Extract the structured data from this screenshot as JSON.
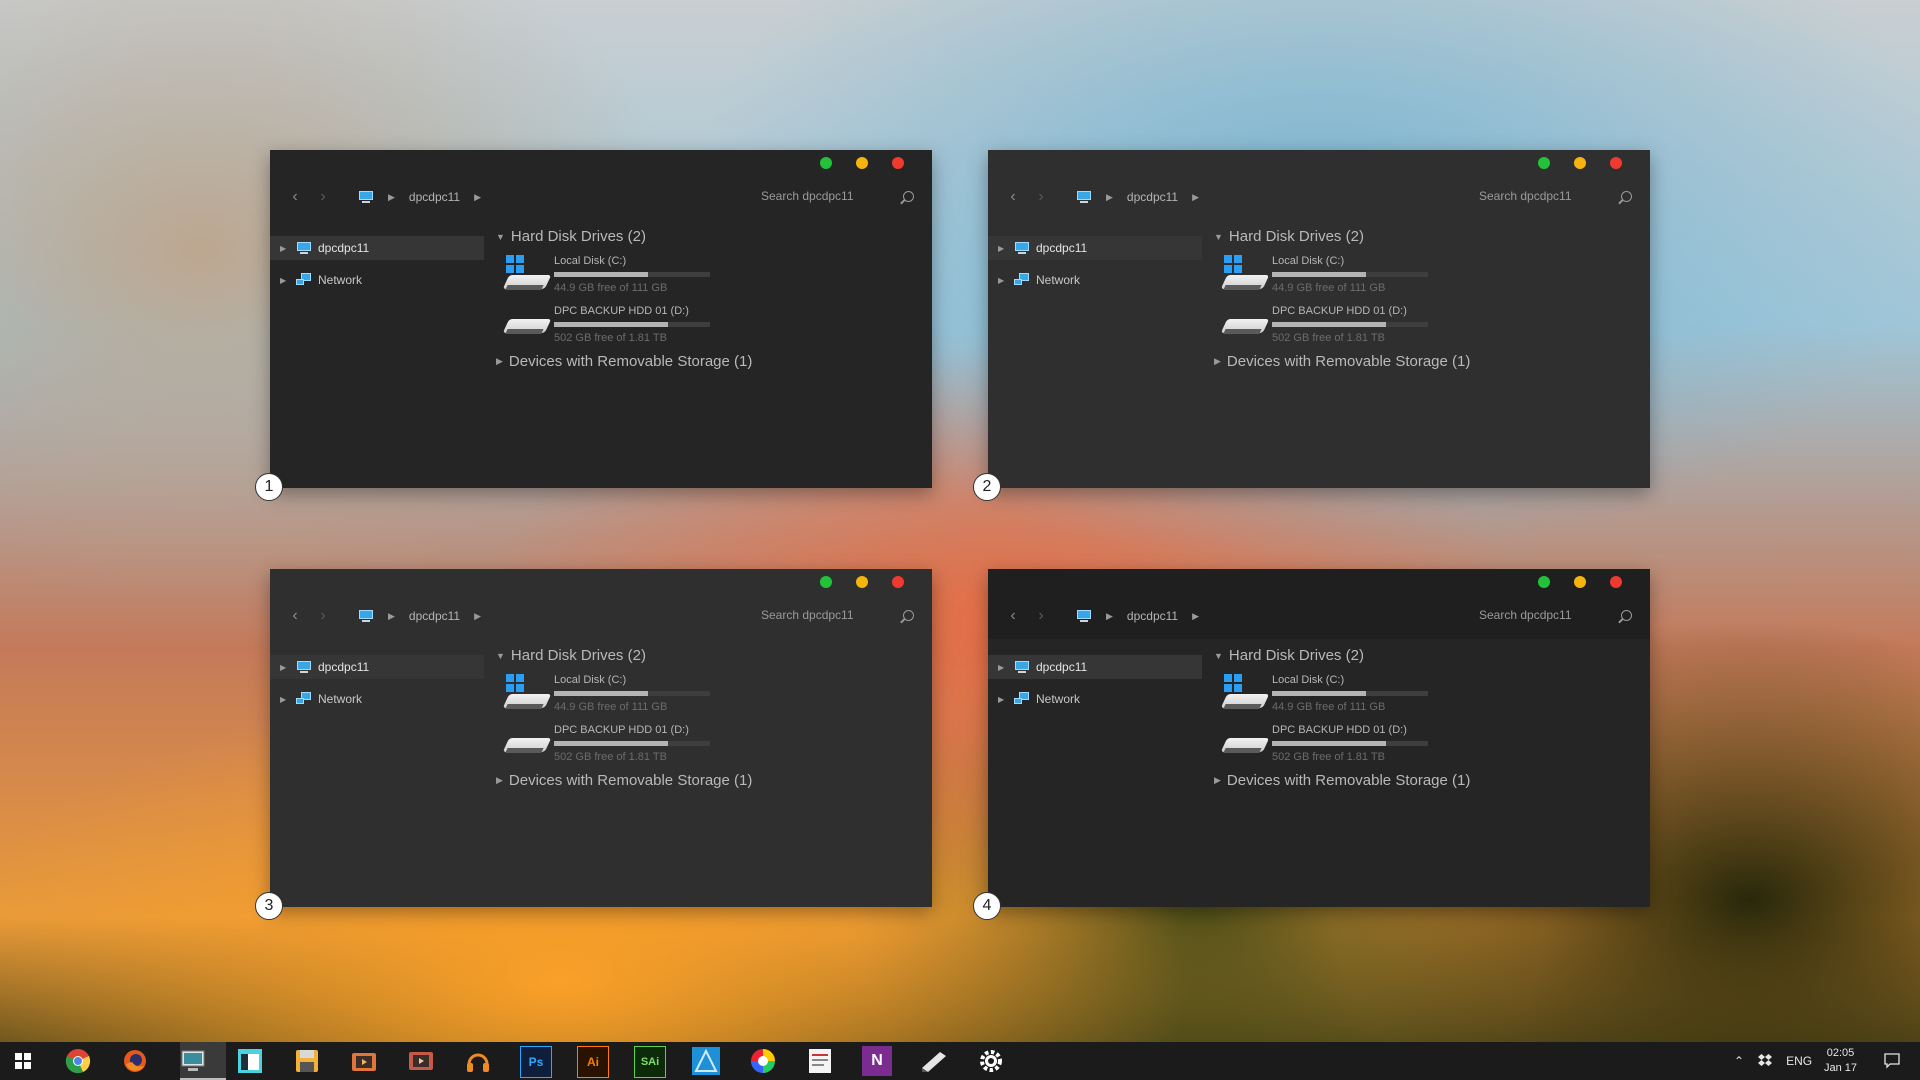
{
  "windows": [
    {
      "badge": "1"
    },
    {
      "badge": "2"
    },
    {
      "badge": "3"
    },
    {
      "badge": "4"
    }
  ],
  "explorer": {
    "breadcrumb": "dpcdpc11",
    "search_placeholder": "Search dpcdpc11",
    "sidebar": [
      {
        "label": "dpcdpc11",
        "icon": "computer-icon",
        "selected": true
      },
      {
        "label": "Network",
        "icon": "network-icon",
        "selected": false
      }
    ],
    "hard_disk_group": "Hard Disk Drives (2)",
    "drives": [
      {
        "name": "Local Disk (C:)",
        "free": "44.9 GB free of 111 GB",
        "used_fraction": 0.6
      },
      {
        "name": "DPC BACKUP HDD 01 (D:)",
        "free": "502 GB free of 1.81 TB",
        "used_fraction": 0.73
      }
    ],
    "removable_group": "Devices with Removable Storage (1)"
  },
  "taskbar": {
    "apps": [
      "windows-start-icon",
      "chrome-icon",
      "firefox-icon",
      "this-pc-icon",
      "window-icon",
      "save-icon",
      "video-icon",
      "video2-icon",
      "headphones-icon",
      "photoshop-icon",
      "illustrator-icon",
      "sai-icon",
      "affinity-icon",
      "color-wheel-icon",
      "notes-icon",
      "onenote-icon",
      "pen-icon",
      "settings-icon"
    ],
    "ps_label": "Ps",
    "ai_label": "Ai",
    "sai_label": "SAi",
    "onenote_label": "N",
    "language": "ENG",
    "time": "02:05",
    "date": "Jan 17"
  },
  "colors": {
    "close": "#f03a30",
    "minimize": "#f5b40e",
    "maximize": "#22c33a",
    "accent": "#3aa6e6"
  }
}
